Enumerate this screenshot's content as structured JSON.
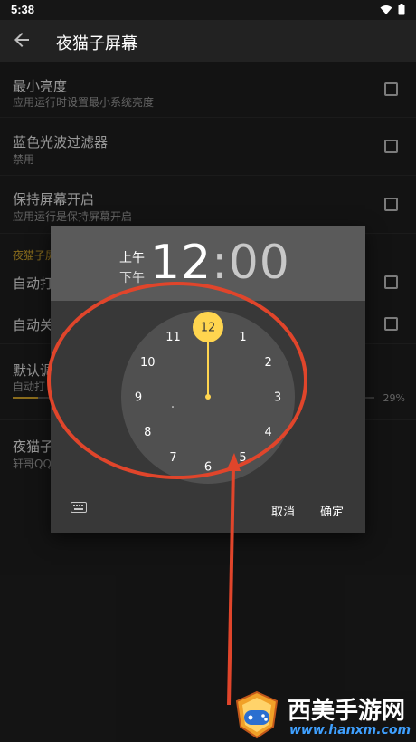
{
  "status_bar": {
    "time": "5:38"
  },
  "app_bar": {
    "title": "夜猫子屏幕"
  },
  "settings": {
    "min_brightness": {
      "title": "最小亮度",
      "subtitle": "应用运行时设置最小系统亮度"
    },
    "blue_filter": {
      "title": "蓝色光波过滤器",
      "subtitle": "禁用"
    },
    "keep_screen_on": {
      "title": "保持屏幕开启",
      "subtitle": "应用运行是保持屏幕开启"
    },
    "section_header": "夜猫子屏",
    "auto_on": {
      "title": "自动打"
    },
    "auto_off": {
      "title": "自动关"
    },
    "default_adjust": {
      "title": "默认调",
      "subtitle": "自动打",
      "value": "29%",
      "fraction": 0.07
    },
    "about": {
      "title": "夜猫子",
      "subtitle": "轩哥QQ"
    }
  },
  "dialog": {
    "am_label": "上午",
    "pm_label": "下午",
    "hour": "12",
    "separator": ":",
    "minute": "00",
    "clock_numbers": [
      "12",
      "1",
      "2",
      "3",
      "4",
      "5",
      "6",
      "7",
      "8",
      "9",
      "10",
      "11"
    ],
    "selected_number": "12",
    "cancel_label": "取消",
    "ok_label": "确定"
  },
  "watermark": {
    "title": "西美手游网",
    "url": "www.hanxm.com"
  },
  "colors": {
    "accent": "#ffd54f",
    "annotation": "#e0452b",
    "section": "#d4a72c"
  }
}
